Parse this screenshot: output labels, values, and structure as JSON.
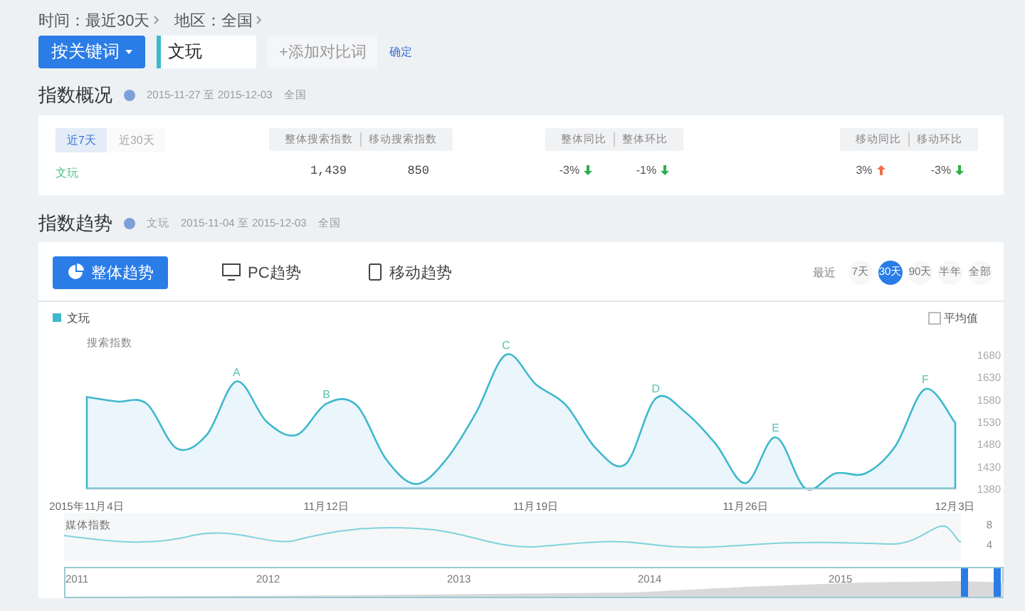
{
  "filters": [
    {
      "text": "时间：最近30天"
    },
    {
      "text": "地区：全国"
    }
  ],
  "search_bar": {
    "mode_button": "按关键词",
    "keyword": "文玩",
    "add_button": "+添加对比词",
    "confirm_link": "确定"
  },
  "overview": {
    "title": "指数概况",
    "range": "2015-11-27 至 2015-12-03",
    "region": "全国",
    "period_tabs": [
      {
        "label": "近7天",
        "selected": true
      },
      {
        "label": "近30天",
        "selected": false
      }
    ],
    "keyword": "文玩",
    "groups": [
      {
        "headers": [
          "整体搜索指数",
          "移动搜索指数"
        ],
        "values": [
          {
            "text": "1,439"
          },
          {
            "text": "850"
          }
        ]
      },
      {
        "headers": [
          "整体同比",
          "整体环比"
        ],
        "values": [
          {
            "text": "-3%",
            "rising": false
          },
          {
            "text": "-1%",
            "rising": false
          }
        ]
      },
      {
        "headers": [
          "移动同比",
          "移动环比"
        ],
        "values": [
          {
            "text": "3%",
            "rising": true
          },
          {
            "text": "-3%",
            "rising": false
          }
        ]
      }
    ]
  },
  "trend": {
    "title": "指数趋势",
    "keyword": "文玩",
    "range": "2015-11-04 至 2015-12-03",
    "region": "全国",
    "tabs": [
      {
        "label": "整体趋势",
        "kind": "overall",
        "selected": true
      },
      {
        "label": "PC趋势",
        "kind": "pc",
        "selected": false
      },
      {
        "label": "移动趋势",
        "kind": "mobile",
        "selected": false
      }
    ],
    "range_label": "最近",
    "ranges": [
      {
        "label": "7天",
        "selected": false
      },
      {
        "label": "30天",
        "selected": true
      },
      {
        "label": "90天",
        "selected": false
      },
      {
        "label": "半年",
        "selected": false
      },
      {
        "label": "全部",
        "selected": false
      }
    ],
    "average_toggle": {
      "label": "平均值",
      "checked": false
    },
    "chart_data": {
      "type": "area",
      "ylabel": "搜索指数",
      "categories": [
        "2015年11月4日",
        null,
        null,
        null,
        null,
        null,
        null,
        null,
        "11月12日",
        null,
        null,
        null,
        null,
        null,
        null,
        "11月19日",
        null,
        null,
        null,
        null,
        null,
        null,
        "11月26日",
        null,
        null,
        null,
        null,
        null,
        null,
        "12月3日"
      ],
      "series": [
        {
          "name": "文玩",
          "color": "#3fb8cc",
          "values": [
            1585,
            1575,
            1570,
            1470,
            1500,
            1620,
            1530,
            1500,
            1570,
            1567,
            1445,
            1390,
            1445,
            1550,
            1680,
            1613,
            1567,
            1470,
            1435,
            1582,
            1550,
            1480,
            1392,
            1495,
            1380,
            1414,
            1414,
            1475,
            1603,
            1527
          ]
        }
      ],
      "ylim": [
        1380,
        1680
      ],
      "yticks": [
        1380,
        1430,
        1480,
        1530,
        1580,
        1630,
        1680
      ],
      "annotations": [
        "A",
        "B",
        "C",
        "D",
        "E",
        "F"
      ]
    },
    "media_chart": {
      "ylabel": "媒体指数",
      "ticks": [
        "8",
        "4"
      ]
    },
    "navigator": {
      "years": [
        "2011",
        "2012",
        "2013",
        "2014",
        "2015"
      ]
    }
  }
}
